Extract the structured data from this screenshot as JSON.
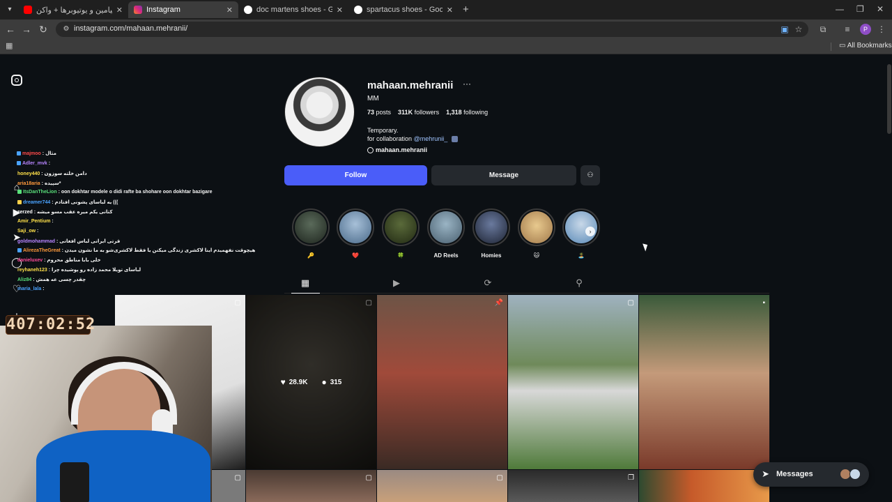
{
  "browser": {
    "tabs": [
      {
        "title": "تصادف بنیامین و یوتیوبرها + واکن",
        "favicon_color": "#ff0000"
      },
      {
        "title": "Instagram",
        "favicon_color": "#e1306c"
      },
      {
        "title": "doc martens shoes - Google Search",
        "favicon_color": "#ffffff"
      },
      {
        "title": "spartacus shoes - Google Search",
        "favicon_color": "#ffffff"
      }
    ],
    "url": "instagram.com/mahaan.mehranii/",
    "bookmarks_label": "All Bookmarks",
    "profile_initial": "P"
  },
  "profile": {
    "username": "mahaan.mehranii",
    "full_name": "MM",
    "stats": {
      "posts_count": "73",
      "posts_label": "posts",
      "followers_count": "311K",
      "followers_label": "followers",
      "following_count": "1,318",
      "following_label": "following"
    },
    "bio_line1": "Temporary.",
    "bio_line2_prefix": "for collaboration",
    "bio_mention": "@mehrunii_",
    "threads_handle": "mahaan.mehranii",
    "follow_label": "Follow",
    "message_label": "Message"
  },
  "highlights": [
    {
      "label": "🔑",
      "color": "#2e3a2e"
    },
    {
      "label": "❤️",
      "color": "#6f8fb0"
    },
    {
      "label": "🍀",
      "color": "#3a4a2a"
    },
    {
      "label": "AD Reels",
      "color": "#6e8a9e"
    },
    {
      "label": "Homies",
      "color": "#3d4a5e"
    },
    {
      "label": "🐱",
      "color": "#c9a36a"
    },
    {
      "label": "🏝️",
      "color": "#7ab0d8"
    }
  ],
  "posts": [
    {
      "overlay": false,
      "likes": "",
      "comments": "",
      "color": "#e9e9e9",
      "badge": "reel-icon"
    },
    {
      "overlay": true,
      "likes": "28.9K",
      "comments": "315",
      "color": "#2b2925",
      "badge": "reel-icon"
    },
    {
      "overlay": false,
      "likes": "",
      "comments": "",
      "color": "#5a4438",
      "badge": "pin-icon"
    },
    {
      "overlay": false,
      "likes": "",
      "comments": "",
      "color": "#6d8a5f",
      "badge": "reel-icon"
    },
    {
      "overlay": false,
      "likes": "",
      "comments": "",
      "color": "#6b5a3e",
      "badge": "pin-icon"
    }
  ],
  "chat": [
    {
      "user": "majmoo",
      "msg": ": مثال",
      "color": "#ff4a4a"
    },
    {
      "user": "Adler_mvk",
      "msg": ":",
      "color": "#b784ff"
    },
    {
      "user": "honey440",
      "msg": ": دامن خلته سوزون",
      "color": "#ffe14a"
    },
    {
      "user": "aria18aria",
      "msg": ": سپیده*",
      "color": "#ff9a3c"
    },
    {
      "user": "ItsDanTheLion",
      "msg": ": oon dokhtar modele o didi rafte ba shohare oon dokhtar bazigare",
      "color": "#59e07a"
    },
    {
      "user": "dreamer744",
      "msg": ": یه لباسای پشونی افتادم (((",
      "color": "#4aa3ff"
    },
    {
      "user": "zerzed",
      "msg": ": کتانی یکم میره عقب مسو میشه",
      "color": "#ffffff"
    },
    {
      "user": "Amir_Pentium",
      "msg": ":",
      "color": "#ffe14a"
    },
    {
      "user": "Saji_ow",
      "msg": ":",
      "color": "#ffe14a"
    },
    {
      "user": "goldmohammad",
      "msg": ": قرتی ایرانی لباس افغانی",
      "color": "#b784ff"
    },
    {
      "user": "AlirezaTheGreat",
      "msg": ": هیچوقت نفهمیدم اینا لاکشری زندگی میکنن یا فقط لاکشری‌شو به ما نشون میدن",
      "color": "#ff9a3c"
    },
    {
      "user": "danieluxev",
      "msg": ": خلی بابا مناطق محروم",
      "color": "#ff4a9a"
    },
    {
      "user": "reyhaneh123",
      "msg": ": لباسای تویلا محمد زاده رو پوشیده چرا",
      "color": "#ffe14a"
    },
    {
      "user": "Aliz84",
      "msg": ": چقدر چسی عه همش",
      "color": "#59e07a"
    },
    {
      "user": "maria_lala",
      "msg": ":",
      "color": "#4aa3ff"
    }
  ],
  "timer": "407:02:52",
  "messages_pill": {
    "label": "Messages"
  }
}
